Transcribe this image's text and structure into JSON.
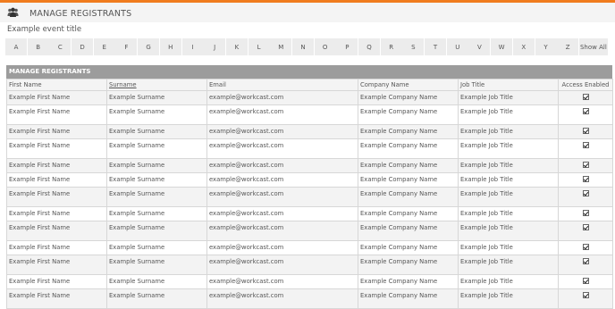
{
  "colors": {
    "accent": "#f07c1e",
    "panel_header": "#9c9c9c",
    "letter_button": "#ececec"
  },
  "header": {
    "icon": "users-icon",
    "title": "MANAGE REGISTRANTS"
  },
  "event_title": "Example event title",
  "letters": [
    "A",
    "B",
    "C",
    "D",
    "E",
    "F",
    "G",
    "H",
    "I",
    "J",
    "K",
    "L",
    "M",
    "N",
    "O",
    "P",
    "Q",
    "R",
    "S",
    "T",
    "U",
    "V",
    "W",
    "X",
    "Y",
    "Z"
  ],
  "show_all": "Show All",
  "panel_title": "MANAGE REGISTRANTS",
  "columns": [
    "First Name",
    "Surname",
    "Email",
    "Company Name",
    "Job Title",
    "Access Enabled"
  ],
  "rows": [
    {
      "first": "Example First Name",
      "surname": "Example Surname",
      "email": "example@workcast.com",
      "company": "Example Company Name",
      "job": "Example Job Title",
      "access": true
    },
    {
      "first": "Example First Name",
      "surname": "Example Surname",
      "email": "example@workcast.com",
      "company": "Example Company Name",
      "job": "Example Job Title",
      "access": true
    },
    {
      "first": "Example First Name",
      "surname": "Example Surname",
      "email": "example@workcast.com",
      "company": "Example Company Name",
      "job": "Example Job Title",
      "access": true
    },
    {
      "first": "Example First Name",
      "surname": "Example Surname",
      "email": "example@workcast.com",
      "company": "Example Company Name",
      "job": "Example Job Title",
      "access": true
    },
    {
      "first": "Example First Name",
      "surname": "Example Surname",
      "email": "example@workcast.com",
      "company": "Example Company Name",
      "job": "Example Job Title",
      "access": true
    },
    {
      "first": "Example First Name",
      "surname": "Example Surname",
      "email": "example@workcast.com",
      "company": "Example Company Name",
      "job": "Example Job Title",
      "access": true
    },
    {
      "first": "Example First Name",
      "surname": "Example Surname",
      "email": "example@workcast.com",
      "company": "Example Company Name",
      "job": "Example Job Title",
      "access": true
    },
    {
      "first": "Example First Name",
      "surname": "Example Surname",
      "email": "example@workcast.com",
      "company": "Example Company Name",
      "job": "Example Job Title",
      "access": true
    },
    {
      "first": "Example First Name",
      "surname": "Example Surname",
      "email": "example@workcast.com",
      "company": "Example Company Name",
      "job": "Example Job Title",
      "access": true
    },
    {
      "first": "Example First Name",
      "surname": "Example Surname",
      "email": "example@workcast.com",
      "company": "Example Company Name",
      "job": "Example Job Title",
      "access": true
    },
    {
      "first": "Example First Name",
      "surname": "Example Surname",
      "email": "example@workcast.com",
      "company": "Example Company Name",
      "job": "Example Job Title",
      "access": true
    },
    {
      "first": "Example First Name",
      "surname": "Example Surname",
      "email": "example@workcast.com",
      "company": "Example Company Name",
      "job": "Example Job Title",
      "access": true
    },
    {
      "first": "Example First Name",
      "surname": "Example Surname",
      "email": "example@workcast.com",
      "company": "Example Company Name",
      "job": "Example Job Title",
      "access": true
    }
  ]
}
